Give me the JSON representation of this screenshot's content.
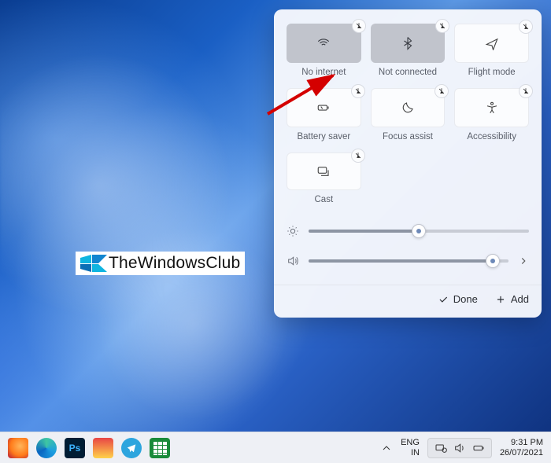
{
  "panel": {
    "tiles": [
      {
        "label": "No internet",
        "icon": "wifi-icon",
        "style": "dark"
      },
      {
        "label": "Not connected",
        "icon": "bluetooth-icon",
        "style": "dark"
      },
      {
        "label": "Flight mode",
        "icon": "airplane-icon",
        "style": "light"
      },
      {
        "label": "Battery saver",
        "icon": "battery-saver-icon",
        "style": "light"
      },
      {
        "label": "Focus assist",
        "icon": "moon-icon",
        "style": "light"
      },
      {
        "label": "Accessibility",
        "icon": "accessibility-icon",
        "style": "light"
      },
      {
        "label": "Cast",
        "icon": "cast-icon",
        "style": "light"
      }
    ],
    "sliders": {
      "brightness": {
        "value": 50
      },
      "volume": {
        "value": 92
      }
    },
    "footer": {
      "done": "Done",
      "add": "Add"
    }
  },
  "watermark": {
    "text": "TheWindowsClub"
  },
  "taskbar": {
    "tray": {
      "chevron": "^",
      "lang_top": "ENG",
      "lang_bottom": "IN",
      "time": "9:31 PM",
      "date": "26/07/2021"
    }
  }
}
